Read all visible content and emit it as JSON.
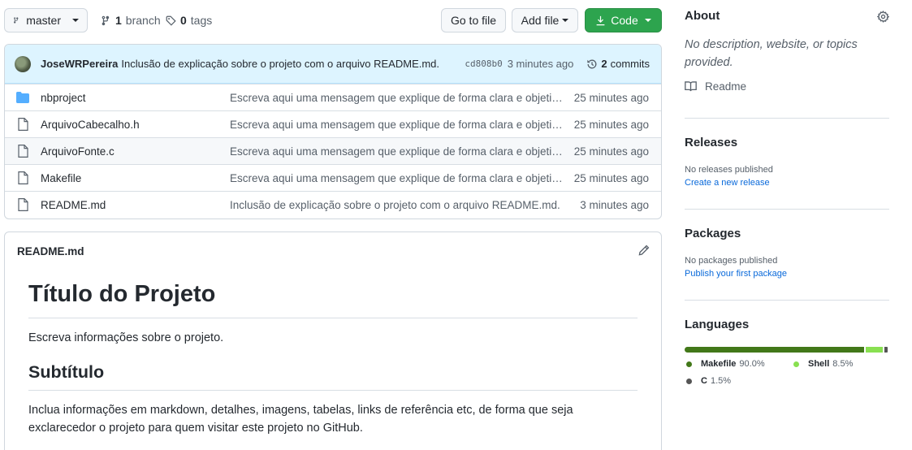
{
  "toolbar": {
    "branch": "master",
    "branches_count": "1",
    "branches_label": "branch",
    "tags_count": "0",
    "tags_label": "tags",
    "goto_label": "Go to file",
    "add_file_label": "Add file",
    "code_label": "Code"
  },
  "commit": {
    "author": "JoseWRPereira",
    "message": "Inclusão de explicação sobre o projeto com o arquivo README.md.",
    "sha": "cd808b0",
    "age": "3 minutes ago",
    "count": "2",
    "count_label": "commits"
  },
  "files": [
    {
      "name": "nbproject",
      "type": "folder",
      "message": "Escreva aqui uma mensagem que explique de forma clara e objetiva as …",
      "age": "25 minutes ago"
    },
    {
      "name": "ArquivoCabecalho.h",
      "type": "file",
      "message": "Escreva aqui uma mensagem que explique de forma clara e objetiva as …",
      "age": "25 minutes ago"
    },
    {
      "name": "ArquivoFonte.c",
      "type": "file",
      "message": "Escreva aqui uma mensagem que explique de forma clara e objetiva as …",
      "age": "25 minutes ago"
    },
    {
      "name": "Makefile",
      "type": "file",
      "message": "Escreva aqui uma mensagem que explique de forma clara e objetiva as …",
      "age": "25 minutes ago"
    },
    {
      "name": "README.md",
      "type": "file",
      "message": "Inclusão de explicação sobre o projeto com o arquivo README.md.",
      "age": "3 minutes ago"
    }
  ],
  "readme": {
    "filename": "README.md",
    "h1": "Título do Projeto",
    "p1": "Escreva informações sobre o projeto.",
    "h2": "Subtítulo",
    "p2": "Inclua informações em markdown, detalhes, imagens, tabelas, links de referência etc, de forma que seja exclarecedor o projeto para quem visitar este projeto no GitHub."
  },
  "sidebar": {
    "about_title": "About",
    "about_desc": "No description, website, or topics provided.",
    "readme_link": "Readme",
    "releases_title": "Releases",
    "releases_empty": "No releases published",
    "releases_link": "Create a new release",
    "packages_title": "Packages",
    "packages_empty": "No packages published",
    "packages_link": "Publish your first package",
    "languages_title": "Languages",
    "languages": [
      {
        "name": "Makefile",
        "percent": "90.0%",
        "value": 90.0,
        "color": "#427819"
      },
      {
        "name": "Shell",
        "percent": "8.5%",
        "value": 8.5,
        "color": "#89e051"
      },
      {
        "name": "C",
        "percent": "1.5%",
        "value": 1.5,
        "color": "#555555"
      }
    ]
  },
  "colors": {
    "accent": "#0969da",
    "code_button": "#2da44e",
    "folder": "#54aeff"
  }
}
